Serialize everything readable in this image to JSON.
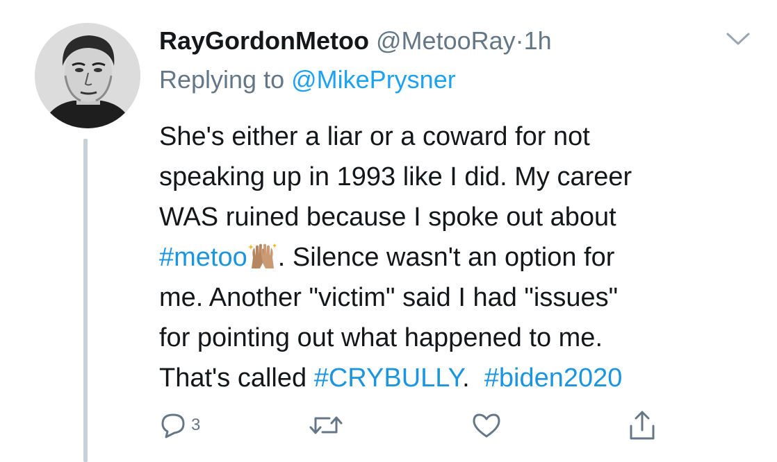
{
  "tweet": {
    "display_name": "RayGordonMetoo",
    "handle": "@MetooRay",
    "separator": "·",
    "time": "1h",
    "reply_prefix": "Replying to",
    "reply_handle": "@MikePrysner",
    "text_lines": {
      "l1": "She's either a liar or a coward for not",
      "l2": "speaking up in 1993 like I did.  My career",
      "l3": "WAS ruined because I spoke out about",
      "l4_hashtag": "#metoo",
      "l4_rest": ".  Silence wasn't an option for",
      "l5": "me.  Another \"victim\" said I had \"issues\"",
      "l6": "for pointing out what happened to me.",
      "l7_prefix": "That's called ",
      "l7_hashtag1": "#CRYBULLY",
      "l7_mid": ".  ",
      "l7_hashtag2": "#biden2020"
    },
    "emoji": "raised-hands-emoji"
  },
  "actions": {
    "reply_count": "3",
    "icons": [
      "reply-icon",
      "retweet-icon",
      "like-icon",
      "share-icon"
    ]
  },
  "colors": {
    "link": "#1da1f2",
    "hashtag": "#1b95e0",
    "secondary_text": "#657786",
    "thread_line": "#c9d1d8"
  }
}
